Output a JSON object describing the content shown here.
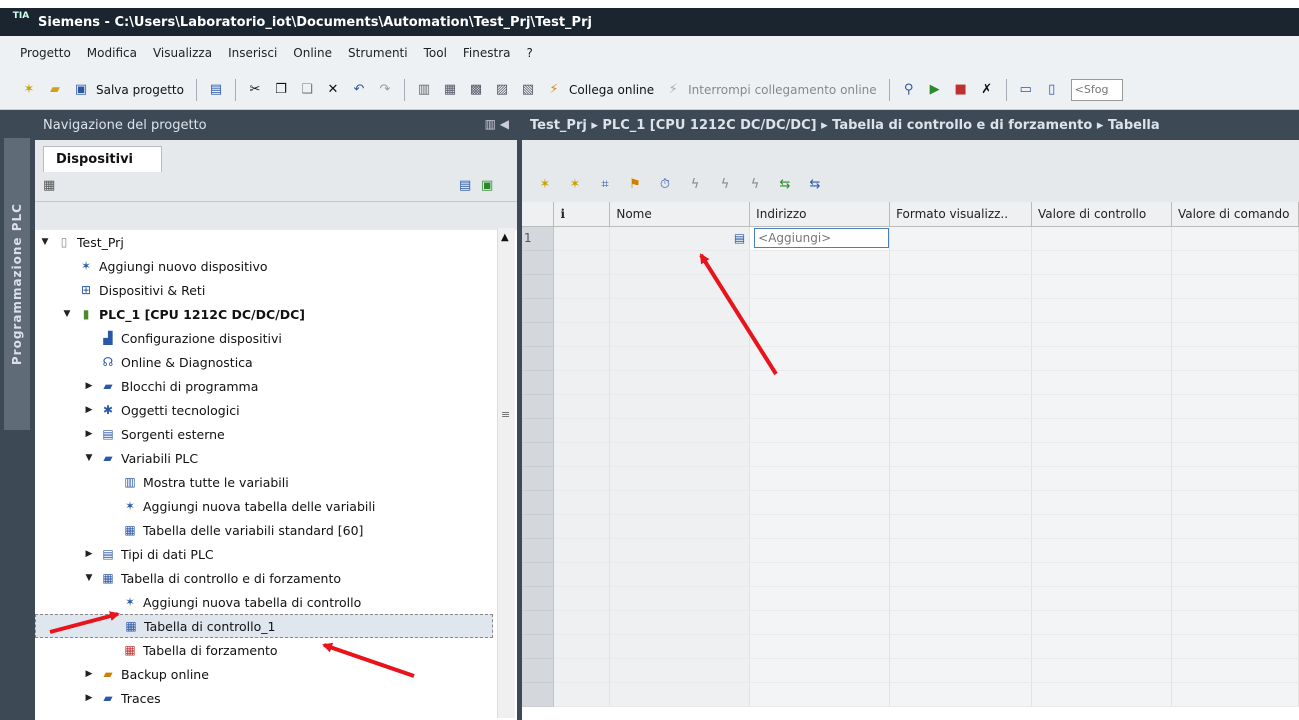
{
  "window": {
    "app_icon": "TIA",
    "title": "Siemens - C:\\Users\\Laboratorio_iot\\Documents\\Automation\\Test_Prj\\Test_Prj"
  },
  "menu": [
    "Progetto",
    "Modifica",
    "Visualizza",
    "Inserisci",
    "Online",
    "Strumenti",
    "Tool",
    "Finestra",
    "?"
  ],
  "toolbar": {
    "save_label": "Salva progetto",
    "go_online_label": "Collega online",
    "go_offline_label": "Interrompi collegamento online",
    "search_placeholder": "<Sfog"
  },
  "sidebar": {
    "vertical_tab": "Programmazione PLC"
  },
  "navigation": {
    "header": "Navigazione del progetto",
    "tab": "Dispositivi",
    "tree": [
      {
        "label": "Test_Prj",
        "level": 0,
        "arrow": "open",
        "icon": "project-icon"
      },
      {
        "label": "Aggiungi nuovo dispositivo",
        "level": 1,
        "arrow": "none",
        "icon": "add-device-icon"
      },
      {
        "label": "Dispositivi & Reti",
        "level": 1,
        "arrow": "none",
        "icon": "network-icon"
      },
      {
        "label": "PLC_1 [CPU 1212C DC/DC/DC]",
        "level": 1,
        "arrow": "open",
        "icon": "plc-icon",
        "bold": true
      },
      {
        "label": "Configurazione dispositivi",
        "level": 2,
        "arrow": "none",
        "icon": "device-config-icon"
      },
      {
        "label": "Online & Diagnostica",
        "level": 2,
        "arrow": "none",
        "icon": "diagnostics-icon"
      },
      {
        "label": "Blocchi di programma",
        "level": 2,
        "arrow": "closed",
        "icon": "folder-blocks-icon"
      },
      {
        "label": "Oggetti tecnologici",
        "level": 2,
        "arrow": "closed",
        "icon": "folder-tech-icon"
      },
      {
        "label": "Sorgenti esterne",
        "level": 2,
        "arrow": "closed",
        "icon": "folder-sources-icon"
      },
      {
        "label": "Variabili PLC",
        "level": 2,
        "arrow": "open",
        "icon": "folder-tags-icon"
      },
      {
        "label": "Mostra tutte le variabili",
        "level": 3,
        "arrow": "none",
        "icon": "show-tags-icon"
      },
      {
        "label": "Aggiungi nuova tabella delle variabili",
        "level": 3,
        "arrow": "none",
        "icon": "add-tag-table-icon"
      },
      {
        "label": "Tabella delle variabili standard [60]",
        "level": 3,
        "arrow": "none",
        "icon": "tag-table-icon"
      },
      {
        "label": "Tipi di dati PLC",
        "level": 2,
        "arrow": "closed",
        "icon": "folder-datatypes-icon"
      },
      {
        "label": "Tabella di controllo e di forzamento",
        "level": 2,
        "arrow": "open",
        "icon": "folder-watch-icon"
      },
      {
        "label": "Aggiungi nuova tabella di controllo",
        "level": 3,
        "arrow": "none",
        "icon": "add-watch-table-icon"
      },
      {
        "label": "Tabella di controllo_1",
        "level": 3,
        "arrow": "none",
        "icon": "watch-table-icon",
        "selected": true
      },
      {
        "label": "Tabella di forzamento",
        "level": 3,
        "arrow": "none",
        "icon": "force-table-icon"
      },
      {
        "label": "Backup online",
        "level": 2,
        "arrow": "closed",
        "icon": "folder-backup-icon"
      },
      {
        "label": "Traces",
        "level": 2,
        "arrow": "closed",
        "icon": "folder-traces-icon"
      }
    ]
  },
  "editor": {
    "breadcrumb": "Test_Prj  ▸  PLC_1 [CPU 1212C DC/DC/DC]  ▸  Tabella di controllo e di forzamento  ▸  Tabella",
    "columns": [
      "",
      "i",
      "Nome",
      "Indirizzo",
      "Formato visualizz..",
      "Valore di controllo",
      "Valore di comando"
    ],
    "rows": [
      {
        "num": "1",
        "name": "",
        "address": "<Aggiungi>"
      }
    ]
  },
  "colors": {
    "dark": "#3d4a56",
    "annotation": "#e8131b",
    "panel": "#e6e9ec"
  }
}
